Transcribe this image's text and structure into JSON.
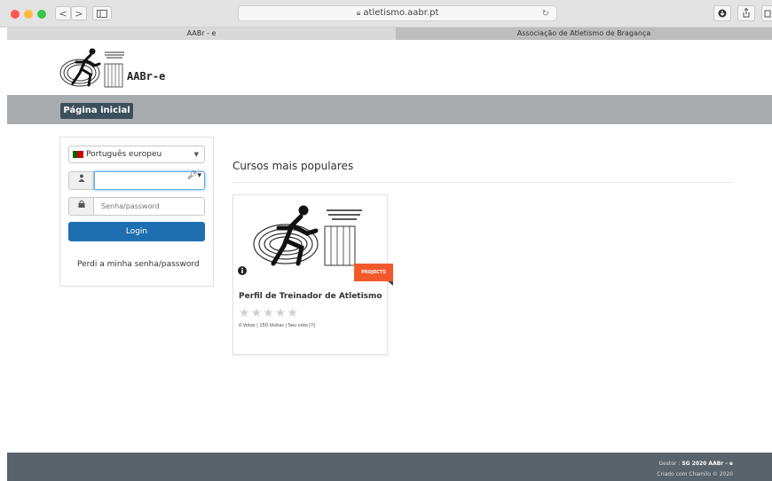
{
  "browser": {
    "url": "atletismo.aabr.pt",
    "back": "<",
    "forward": ">",
    "tabs": [
      {
        "label": "AABr - e"
      },
      {
        "label": "Associação de Atletismo de Bragança"
      }
    ],
    "colors": {
      "close": "#fc5753",
      "minimize": "#fdbc40",
      "maximize": "#33c748"
    }
  },
  "site": {
    "brand": "AABr-e",
    "nav": {
      "home_label": "Página inicial"
    },
    "login": {
      "language": "Português europeu",
      "username_placeholder": "",
      "password_placeholder": "Senha/password",
      "login_label": "Login",
      "forgot_label": "Perdi a minha senha/password"
    },
    "main": {
      "heading": "Cursos mais populares",
      "course": {
        "title": "Perfil de Treinador de Atletismo",
        "ribbon": "PROJECTS",
        "rating": 0,
        "votes_text": "0 Votos | 150 Visitas | Seu voto [?]"
      }
    },
    "footer": {
      "manager_prefix": "Gestor : ",
      "manager": "SG 2020 AABr - e",
      "credit": "Criado com Chamilo © 2020"
    },
    "colors": {
      "accent": "#1e6fb0",
      "ribbon": "#f1592a",
      "nav_button": "#3b4f5c",
      "footer": "#58636b"
    }
  }
}
